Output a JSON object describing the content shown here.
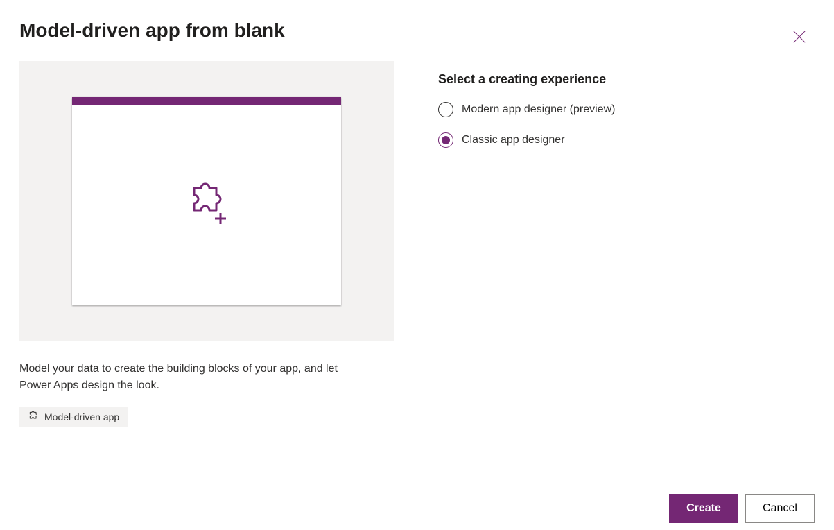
{
  "title": "Model-driven app from blank",
  "description": "Model your data to create the building blocks of your app, and let Power Apps design the look.",
  "tag": {
    "label": "Model-driven app"
  },
  "rightPanel": {
    "heading": "Select a creating experience",
    "options": [
      {
        "label": "Modern app designer (preview)",
        "selected": false
      },
      {
        "label": "Classic app designer",
        "selected": true
      }
    ]
  },
  "footer": {
    "create": "Create",
    "cancel": "Cancel"
  },
  "colors": {
    "accent": "#742774"
  }
}
